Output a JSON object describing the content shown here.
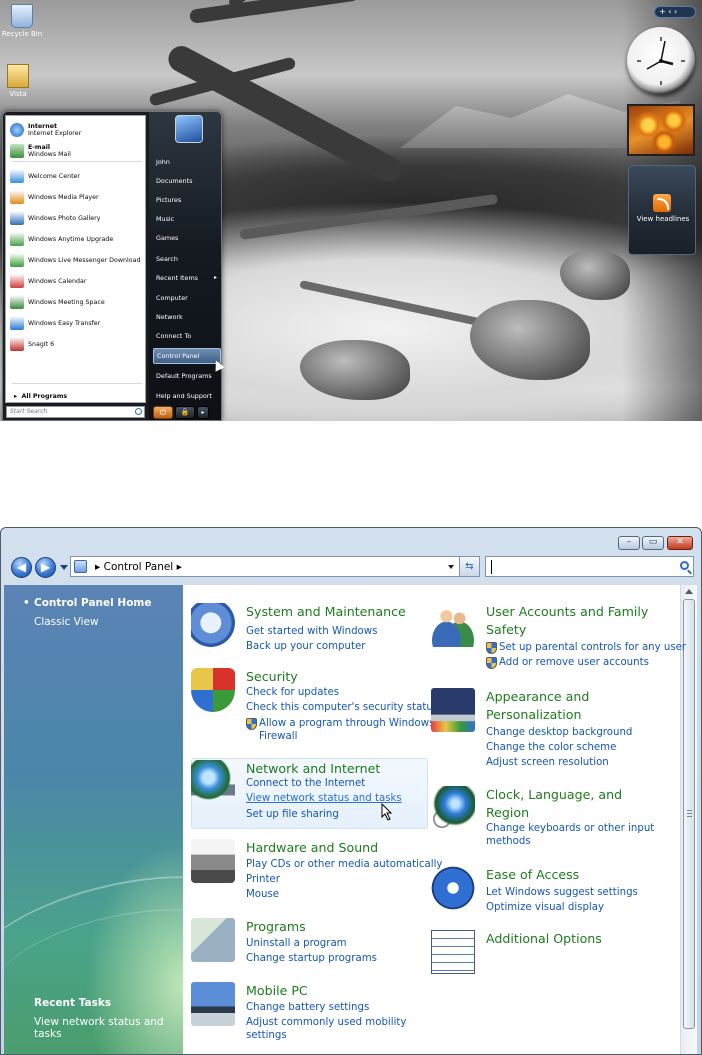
{
  "desktop": {
    "icons": [
      {
        "label": "Recycle Bin"
      },
      {
        "label": "Vista"
      }
    ],
    "gadget_bar": "+ ‹ ›",
    "feed_gadget": {
      "label": "View headlines"
    }
  },
  "start_menu": {
    "pinned": [
      {
        "title": "Internet",
        "subtitle": "Internet Explorer",
        "color": "#2a7ad6"
      },
      {
        "title": "E-mail",
        "subtitle": "Windows Mail",
        "color": "#3d8f3d"
      }
    ],
    "recent": [
      {
        "label": "Welcome Center",
        "color": "#3a8fd8"
      },
      {
        "label": "Windows Media Player",
        "color": "#e08a1a"
      },
      {
        "label": "Windows Photo Gallery",
        "color": "#2f6fb8"
      },
      {
        "label": "Windows Anytime Upgrade",
        "color": "#4aa04a"
      },
      {
        "label": "Windows Live Messenger Download",
        "color": "#3aa03a"
      },
      {
        "label": "Windows Calendar",
        "color": "#d04040"
      },
      {
        "label": "Windows Meeting Space",
        "color": "#3a8a3a"
      },
      {
        "label": "Windows Easy Transfer",
        "color": "#2a7ad6"
      },
      {
        "label": "SnagIt 6",
        "color": "#c03030"
      }
    ],
    "all_programs": "All Programs",
    "search_placeholder": "Start Search",
    "right_items": [
      {
        "label": "John"
      },
      {
        "label": "Documents"
      },
      {
        "label": "Pictures"
      },
      {
        "label": "Music"
      },
      {
        "label": "Games"
      },
      {
        "label": "Search"
      },
      {
        "label": "Recent Items",
        "arrow": "▸"
      },
      {
        "label": "Computer"
      },
      {
        "label": "Network"
      },
      {
        "label": "Connect To"
      },
      {
        "label": "Control Panel",
        "highlighted": true
      },
      {
        "label": "Default Programs"
      },
      {
        "label": "Help and Support"
      }
    ],
    "power_symbol": "⏻",
    "lock_symbol": "🔒",
    "more_symbol": "▸"
  },
  "control_panel": {
    "window_buttons": {
      "minimize": "–",
      "maximize": "▭",
      "close": "✕"
    },
    "nav": {
      "back": "◀",
      "forward": "▶"
    },
    "address": "▸  Control Panel  ▸",
    "search_value": "",
    "nav_pane": {
      "home": "Control Panel Home",
      "classic": "Classic View",
      "recent_title": "Recent Tasks",
      "recent_item": "View network status and tasks"
    },
    "categories_left": [
      {
        "title": "System and Maintenance",
        "links": [
          "Get started with Windows",
          "Back up your computer"
        ]
      },
      {
        "title": "Security",
        "links": [
          "Check for updates",
          "Check this computer's security status",
          "Allow a program through Windows",
          "Firewall"
        ]
      },
      {
        "title": "Network and Internet",
        "links": [
          "Connect to the Internet",
          "View network status and tasks",
          "Set up file sharing"
        ]
      },
      {
        "title": "Hardware and Sound",
        "links": [
          "Play CDs or other media automatically",
          "Printer",
          "Mouse"
        ]
      },
      {
        "title": "Programs",
        "links": [
          "Uninstall a program",
          "Change startup programs"
        ]
      },
      {
        "title": "Mobile PC",
        "links": [
          "Change battery settings",
          "Adjust commonly used mobility",
          "settings"
        ]
      }
    ],
    "categories_right": [
      {
        "title": [
          "User Accounts and Family",
          "Safety"
        ],
        "links": [
          "Set up parental controls for any user",
          "Add or remove user accounts"
        ]
      },
      {
        "title": [
          "Appearance and",
          "Personalization"
        ],
        "links": [
          "Change desktop background",
          "Change the color scheme",
          "Adjust screen resolution"
        ]
      },
      {
        "title": [
          "Clock, Language, and",
          "Region"
        ],
        "links": [
          "Change keyboards or other input",
          "methods"
        ]
      },
      {
        "title": [
          "Ease of Access"
        ],
        "links": [
          "Let Windows suggest settings",
          "Optimize visual display"
        ]
      },
      {
        "title": [
          "Additional Options"
        ],
        "links": []
      }
    ]
  }
}
